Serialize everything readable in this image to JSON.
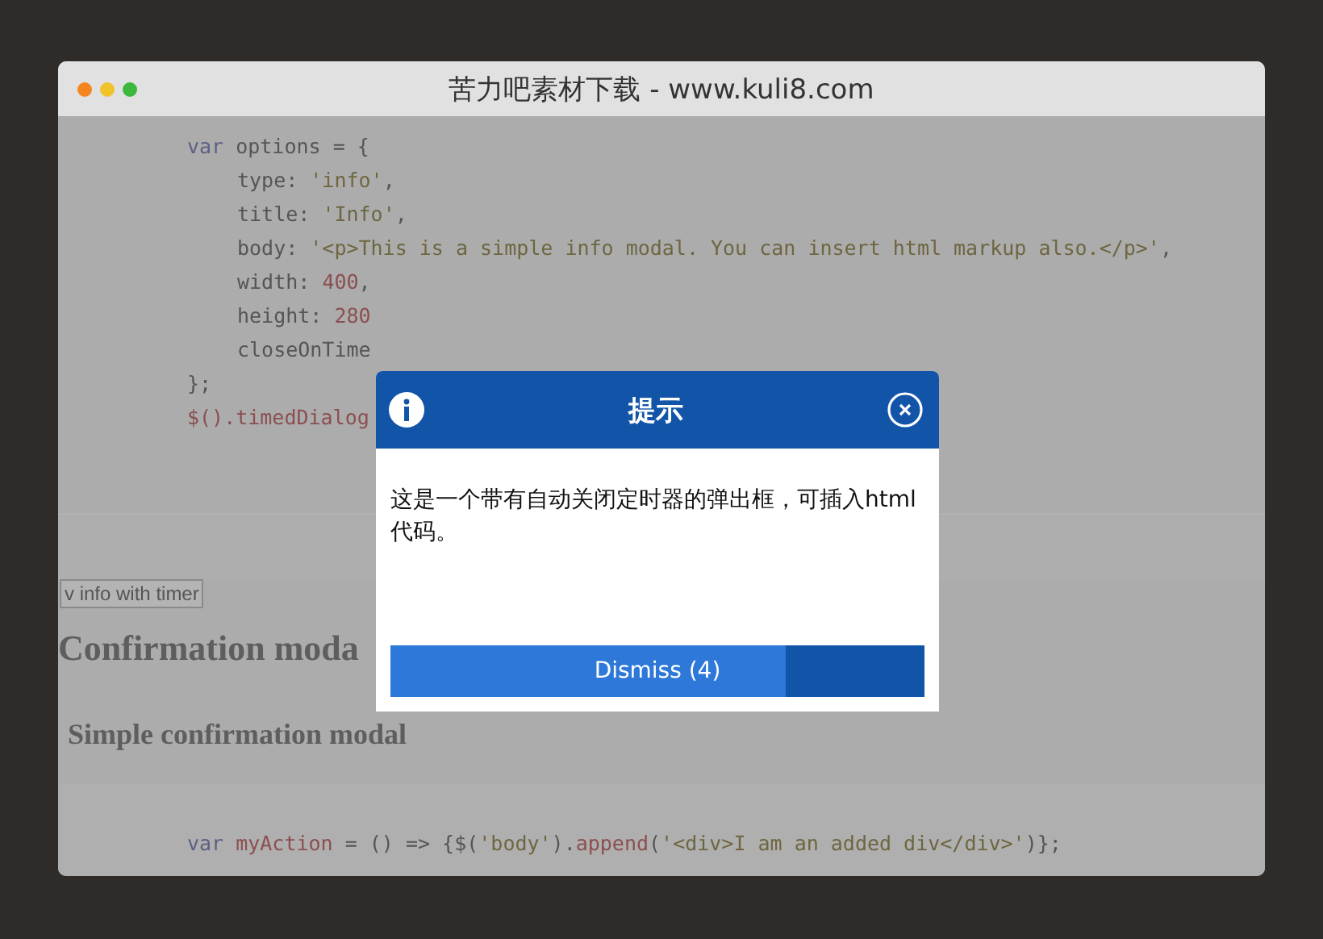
{
  "window": {
    "title": "苦力吧素材下载 - www.kuli8.com"
  },
  "code_top": [
    {
      "indented": false,
      "tokens": [
        {
          "kind": "keyword",
          "text": "var"
        },
        {
          "kind": "plain",
          "text": "options = {"
        }
      ]
    },
    {
      "indented": true,
      "tokens": [
        {
          "kind": "plain",
          "text": "type: "
        },
        {
          "kind": "string",
          "text": "'info'"
        },
        {
          "kind": "plain",
          "text": ","
        }
      ]
    },
    {
      "indented": true,
      "tokens": [
        {
          "kind": "plain",
          "text": "title: "
        },
        {
          "kind": "string",
          "text": "'Info'"
        },
        {
          "kind": "plain",
          "text": ","
        }
      ]
    },
    {
      "indented": true,
      "tokens": [
        {
          "kind": "plain",
          "text": "body: "
        },
        {
          "kind": "string",
          "text": "'<p>This is a simple info modal. You can insert html markup also.</p>'"
        },
        {
          "kind": "plain",
          "text": ","
        }
      ]
    },
    {
      "indented": true,
      "tokens": [
        {
          "kind": "plain",
          "text": "width: "
        },
        {
          "kind": "number",
          "text": "400"
        },
        {
          "kind": "plain",
          "text": ","
        }
      ]
    },
    {
      "indented": true,
      "tokens": [
        {
          "kind": "plain",
          "text": "height: "
        },
        {
          "kind": "number",
          "text": "280"
        }
      ]
    },
    {
      "indented": true,
      "tokens": [
        {
          "kind": "plain",
          "text": "closeOnTime"
        }
      ]
    },
    {
      "indented": false,
      "tokens": [
        {
          "kind": "plain",
          "text": "};"
        }
      ]
    },
    {
      "indented": false,
      "tokens": [
        {
          "kind": "number",
          "text": "$().timedDialog"
        }
      ]
    }
  ],
  "demo_button": "v info with timer",
  "heading": "Confirmation moda",
  "subheading": "Simple confirmation modal",
  "code_bottom": [
    {
      "indented": false,
      "tokens": [
        {
          "kind": "keyword",
          "text": "var"
        },
        {
          "kind": "number",
          "text": "myAction"
        },
        {
          "kind": "plain",
          "text": " = () => {$("
        },
        {
          "kind": "string",
          "text": "'body'"
        },
        {
          "kind": "plain",
          "text": ")."
        },
        {
          "kind": "number",
          "text": "append"
        },
        {
          "kind": "plain",
          "text": "("
        },
        {
          "kind": "string",
          "text": "'<div>I am an added div</div>'"
        },
        {
          "kind": "plain",
          "text": ")};"
        }
      ]
    }
  ],
  "modal": {
    "title": "提示",
    "body": "这是一个带有自动关闭定时器的弹出框，可插入html代码。",
    "dismiss": {
      "label": "Dismiss (4)",
      "level": 0.74
    }
  }
}
